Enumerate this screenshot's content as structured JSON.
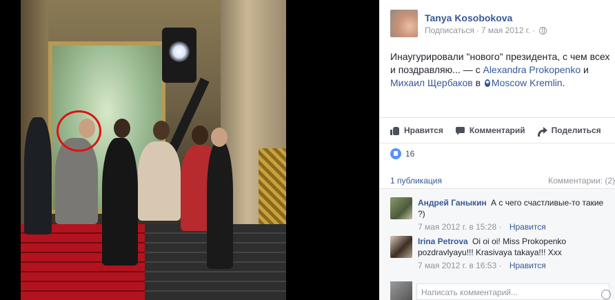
{
  "post": {
    "author": "Tanya Kosobokova",
    "subscribe": "Подписаться",
    "separator": "·",
    "date": "7 мая 2012 г.",
    "date_separator": "·",
    "text_line1": "Инаугурировали \"нового\" президента, с чем всех",
    "text_line2_start": "и поздравляю... — с ",
    "tag1": "Alexandra Prokopenko",
    "and": " и",
    "tag2": "Михаил Щербаков",
    "in": " в ",
    "place": "Moscow Kremlin",
    "period": "."
  },
  "actions": {
    "like": "Нравится",
    "comment": "Комментарий",
    "share": "Поделиться"
  },
  "likes_count": "16",
  "stats": {
    "shares": "1 публикация",
    "comments": "Комментарии: (2)"
  },
  "comments": [
    {
      "name": "Андрей Ганыкин",
      "text": "А с чего счастливые-то такие ?)",
      "date": "7 мая 2012 г. в 15:28",
      "separator": "·",
      "reply": "Нравится"
    },
    {
      "name": "Irina Petrova",
      "text": "Oi oi oi! Miss Prokopenko pozdravlyayu!!! Krasivaya takaya!!! Xxx",
      "date": "7 мая 2012 г. в 16:53",
      "separator": "·",
      "reply": "Нравится"
    }
  ],
  "composer": {
    "placeholder": "Написать комментарий..."
  },
  "icons": {
    "globe": "globe-icon",
    "location": "pin-icon",
    "like": "thumbs-up-icon",
    "comment": "speech-bubble-icon",
    "share": "share-arrow-icon",
    "emoji": "smiley-icon",
    "camera": "camera-icon",
    "sticker": "sticker-icon"
  },
  "colors": {
    "link": "#365899",
    "like_badge": "#5890ff",
    "highlight_circle": "#e01010"
  }
}
